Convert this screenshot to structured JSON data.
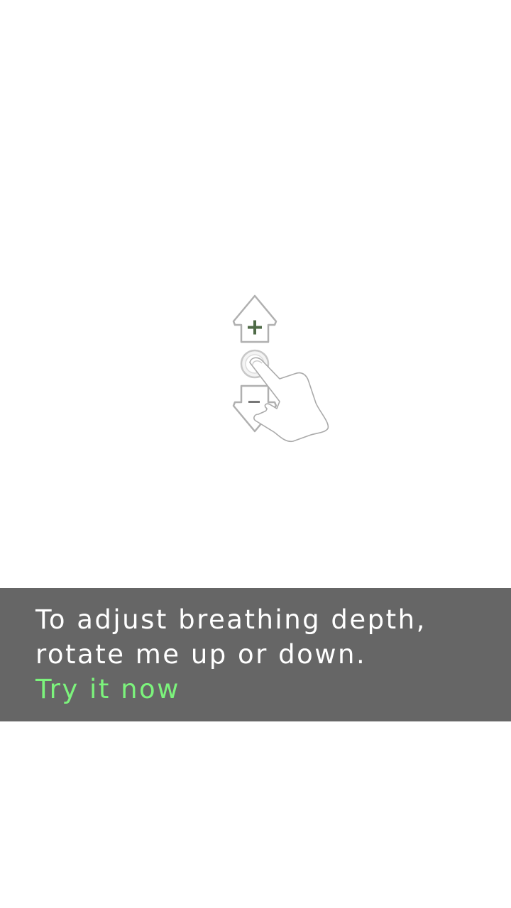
{
  "tutorial": {
    "line1": "To adjust breathing depth,",
    "line2": "rotate me up or down.",
    "action_label": "Try it now"
  },
  "gesture": {
    "up_symbol": "+",
    "down_symbol": "−"
  },
  "colors": {
    "background": "#ffffff",
    "banner": "#666666",
    "text": "#ffffff",
    "accent": "#7cf37c",
    "arrow_stroke": "#b0b0b0",
    "plus": "#4f6b47"
  },
  "icons": [
    "arrow-up-icon",
    "arrow-down-icon",
    "plus-icon",
    "minus-icon",
    "touch-circle-icon",
    "hand-icon"
  ]
}
